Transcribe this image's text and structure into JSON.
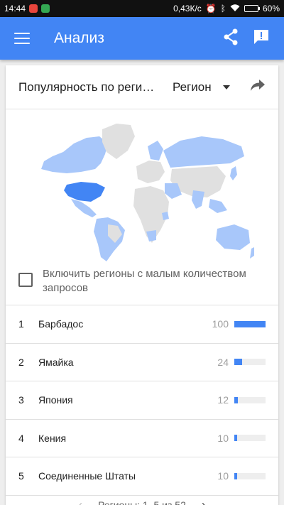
{
  "status": {
    "time": "14:44",
    "speed": "0,43К/с",
    "battery": "60%",
    "battery_level": 0.6
  },
  "appbar": {
    "title": "Анализ"
  },
  "card": {
    "title": "Популярность по регионам",
    "region_label": "Регион"
  },
  "map_colors": {
    "highlight": "#a8c7fa",
    "strong": "#4285f4",
    "neutral": "#e0e0e0"
  },
  "checkbox": {
    "label": "Включить регионы с малым количеством запросов",
    "checked": false
  },
  "regions": [
    {
      "rank": "1",
      "name": "Барбадос",
      "value": "100",
      "level": 1.0
    },
    {
      "rank": "2",
      "name": "Ямайка",
      "value": "24",
      "level": 0.24
    },
    {
      "rank": "3",
      "name": "Япония",
      "value": "12",
      "level": 0.12
    },
    {
      "rank": "4",
      "name": "Кения",
      "value": "10",
      "level": 0.1
    },
    {
      "rank": "5",
      "name": "Соединенные Штаты",
      "value": "10",
      "level": 0.1
    }
  ],
  "pager": {
    "label": "Регионы: 1–5 из 52"
  }
}
